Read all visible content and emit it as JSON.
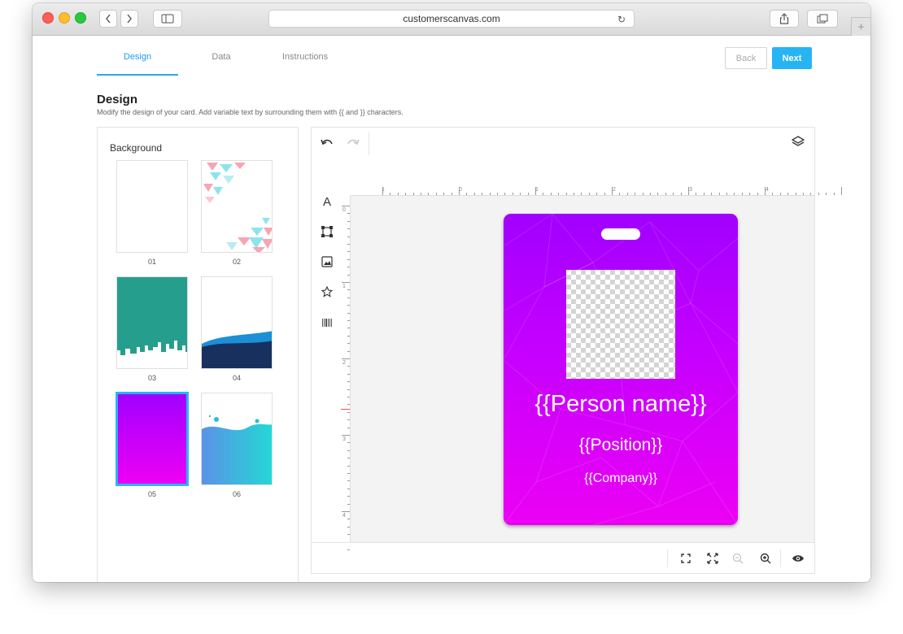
{
  "browser": {
    "url": "customerscanvas.com"
  },
  "tabs": [
    {
      "label": "Design",
      "active": true
    },
    {
      "label": "Data",
      "active": false
    },
    {
      "label": "Instructions",
      "active": false
    }
  ],
  "nav": {
    "back_label": "Back",
    "next_label": "Next"
  },
  "page": {
    "title": "Design",
    "subtitle": "Modify the design of your card. Add variable text by surrounding them with {{ and }} characters."
  },
  "background_panel": {
    "heading": "Background",
    "items": [
      {
        "label": "01",
        "selected": false
      },
      {
        "label": "02",
        "selected": false
      },
      {
        "label": "03",
        "selected": false
      },
      {
        "label": "04",
        "selected": false
      },
      {
        "label": "05",
        "selected": true
      },
      {
        "label": "06",
        "selected": false
      }
    ]
  },
  "toolbar": {
    "top": [
      "undo-icon",
      "redo-icon",
      "layers-icon"
    ],
    "left": [
      "text-tool-icon",
      "shape-tool-icon",
      "image-tool-icon",
      "clipart-tool-icon",
      "barcode-tool-icon"
    ],
    "bottom": [
      "fit-to-screen-icon",
      "fit-to-width-icon",
      "zoom-out-icon",
      "zoom-in-icon",
      "preview-icon"
    ]
  },
  "rulers": {
    "horizontal": [
      "1",
      "0",
      "1",
      "2",
      "3",
      "4"
    ],
    "vertical": [
      "0",
      "1",
      "2",
      "3",
      "4"
    ]
  },
  "card": {
    "person_name": "{{Person name}}",
    "position": "{{Position}}",
    "company": "{{Company}}",
    "colors": {
      "top": "#a100ff",
      "bottom": "#ec00f4"
    }
  },
  "colors": {
    "accent": "#26b4f4",
    "selection": "#2ab4f7"
  }
}
